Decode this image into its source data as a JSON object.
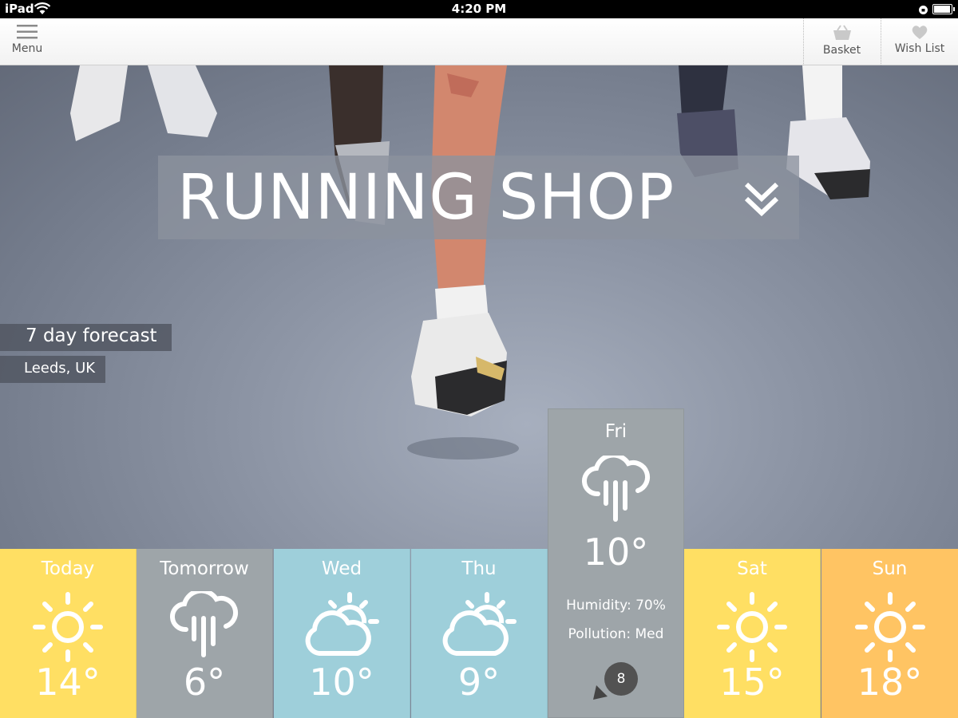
{
  "status_bar": {
    "device": "iPad",
    "time": "4:20 PM"
  },
  "nav": {
    "menu_label": "Menu",
    "basket_label": "Basket",
    "wishlist_label": "Wish List"
  },
  "hero": {
    "title": "RUNNING SHOP"
  },
  "forecast": {
    "heading": "7 day forecast",
    "location": "Leeds, UK",
    "days": [
      {
        "day": "Today",
        "icon": "sun-icon",
        "temp": "14°",
        "color": "#ffdf63"
      },
      {
        "day": "Tomorrow",
        "icon": "rain-cloud-icon",
        "temp": "6°",
        "color": "#9ea5a9"
      },
      {
        "day": "Wed",
        "icon": "partly-cloudy-icon",
        "temp": "10°",
        "color": "#9ecfda"
      },
      {
        "day": "Thu",
        "icon": "partly-cloudy-icon",
        "temp": "9°",
        "color": "#9ecfda"
      },
      {
        "day": "Sat",
        "icon": "sun-icon",
        "temp": "15°",
        "color": "#ffdf63"
      },
      {
        "day": "Sun",
        "icon": "sun-icon",
        "temp": "18°",
        "color": "#ffc463"
      }
    ],
    "selected": {
      "day": "Fri",
      "icon": "rain-cloud-icon",
      "temp": "10°",
      "humidity": "Humidity: 70%",
      "pollution": "Pollution: Med",
      "wind": "8",
      "color": "#9ea5a9"
    }
  }
}
